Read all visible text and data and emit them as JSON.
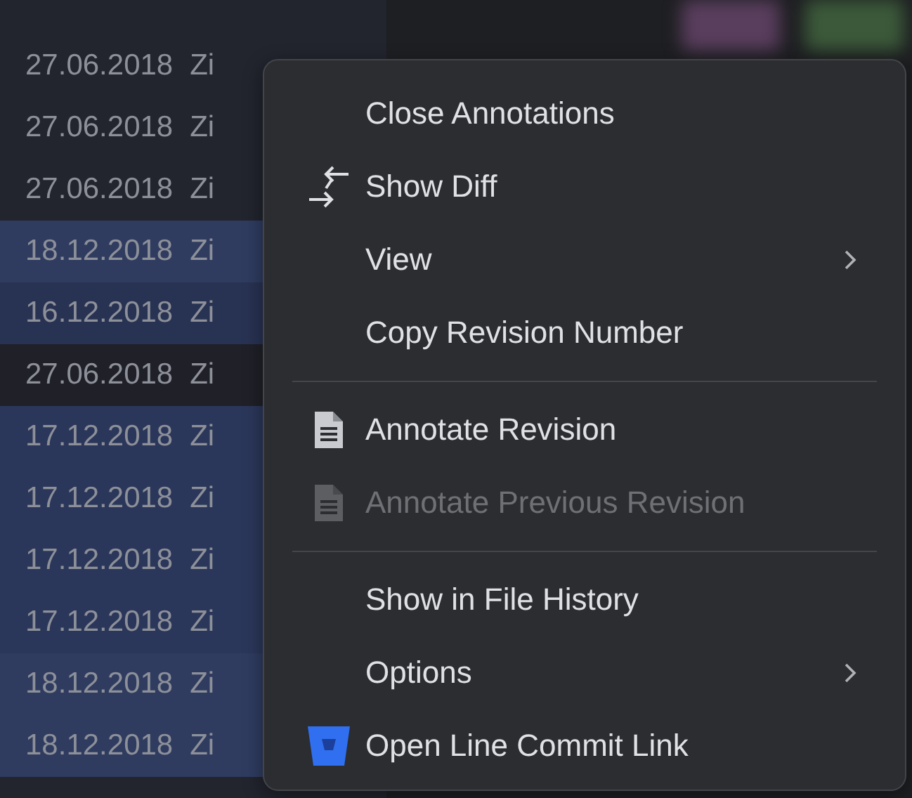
{
  "gutter": {
    "rows": [
      {
        "date": "27.06.2018",
        "author": "Zi",
        "color": "#22242e"
      },
      {
        "date": "27.06.2018",
        "author": "Zi",
        "color": "#22242e"
      },
      {
        "date": "27.06.2018",
        "author": "Zi",
        "color": "#22242e"
      },
      {
        "date": "18.12.2018",
        "author": "Zi",
        "color": "#2f3c60"
      },
      {
        "date": "16.12.2018",
        "author": "Zi",
        "color": "#283252"
      },
      {
        "date": "27.06.2018",
        "author": "Zi",
        "color": "#1f2028"
      },
      {
        "date": "17.12.2018",
        "author": "Zi",
        "color": "#2b375a"
      },
      {
        "date": "17.12.2018",
        "author": "Zi",
        "color": "#2b375a"
      },
      {
        "date": "17.12.2018",
        "author": "Zi",
        "color": "#2b375a"
      },
      {
        "date": "17.12.2018",
        "author": "Zi",
        "color": "#2b375a"
      },
      {
        "date": "18.12.2018",
        "author": "Zi",
        "color": "#2f3c60"
      },
      {
        "date": "18.12.2018",
        "author": "Zi",
        "color": "#2f3c60"
      }
    ]
  },
  "context_menu": {
    "items": [
      {
        "kind": "item",
        "label": "Close Annotations",
        "disabled": false
      },
      {
        "kind": "diff",
        "label": "Show Diff",
        "disabled": false
      },
      {
        "kind": "submenu",
        "label": "View",
        "disabled": false
      },
      {
        "kind": "item",
        "label": "Copy Revision Number",
        "disabled": false
      },
      {
        "kind": "separator"
      },
      {
        "kind": "document",
        "label": "Annotate Revision",
        "disabled": false
      },
      {
        "kind": "document",
        "label": "Annotate Previous Revision",
        "disabled": true
      },
      {
        "kind": "separator"
      },
      {
        "kind": "item",
        "label": "Show in File History",
        "disabled": false
      },
      {
        "kind": "submenu",
        "label": "Options",
        "disabled": false
      },
      {
        "kind": "bucket",
        "label": "Open Line Commit Link",
        "disabled": false
      }
    ]
  }
}
